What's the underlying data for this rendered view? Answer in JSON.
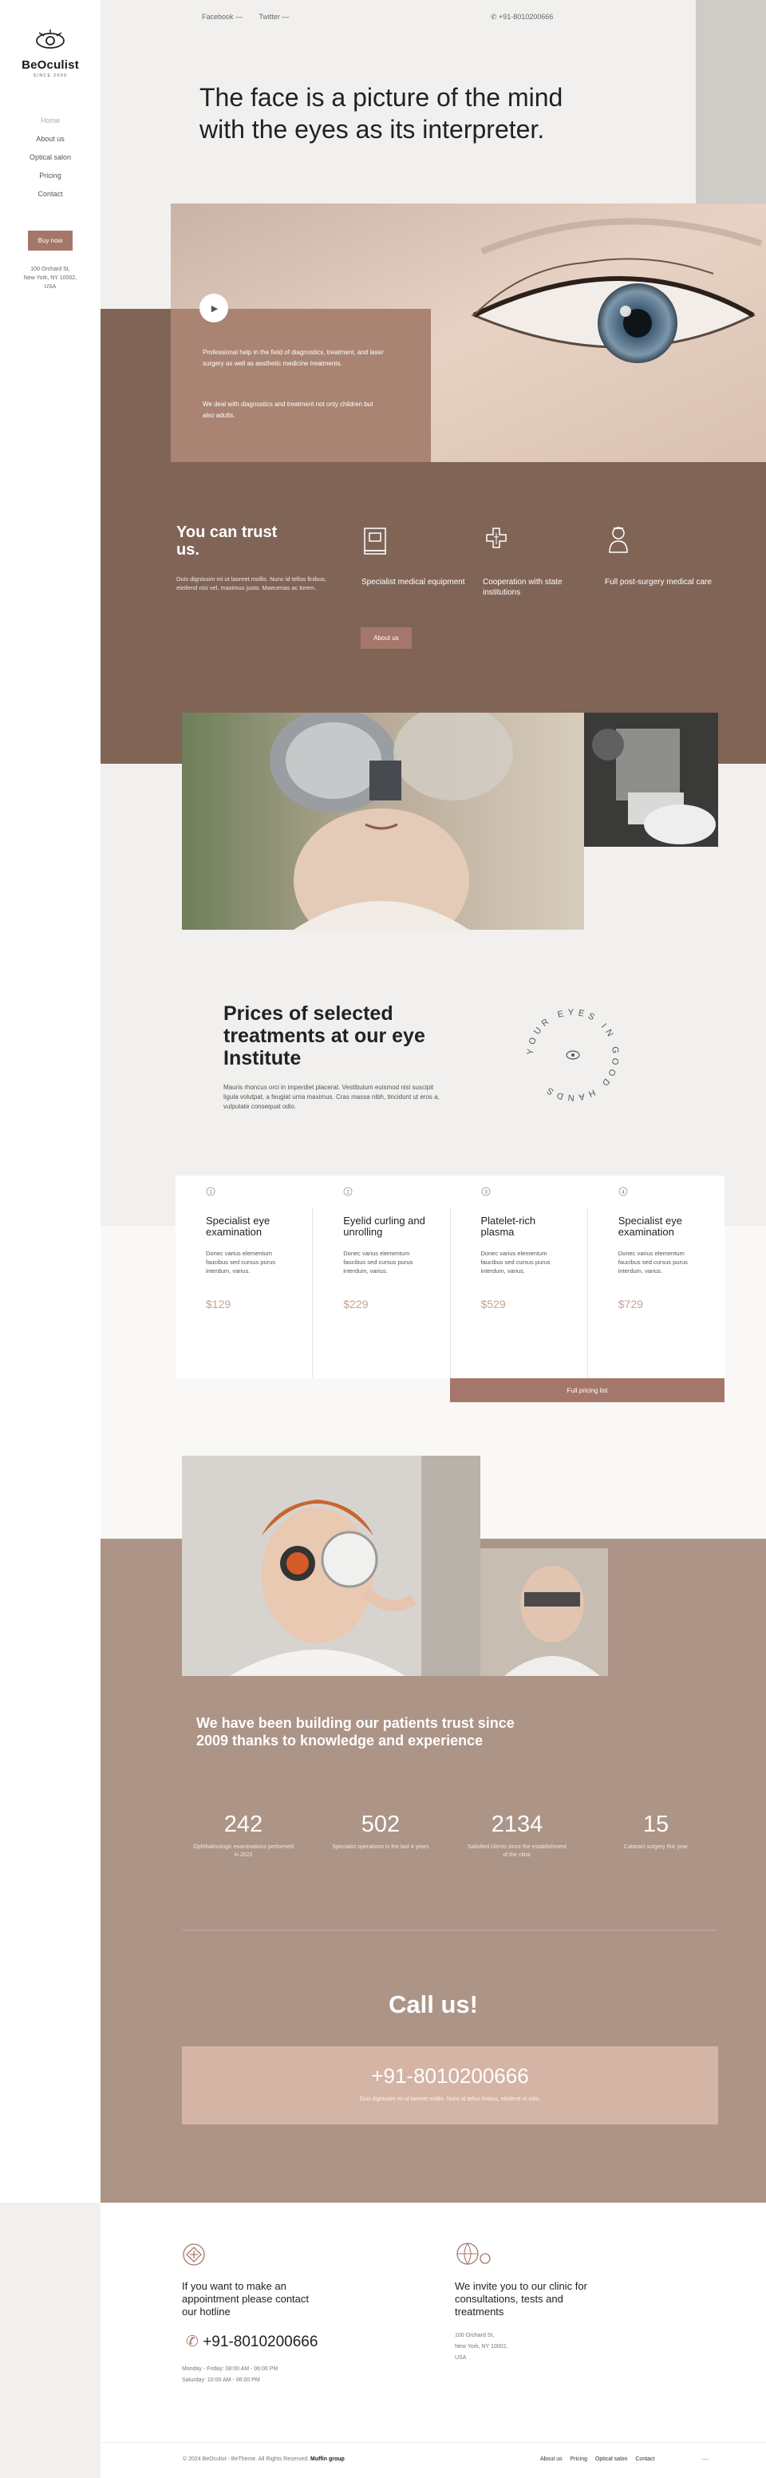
{
  "brand": {
    "name": "BeOculist",
    "tagline": "SINCE 2009"
  },
  "nav": {
    "items": [
      "Home",
      "About us",
      "Optical salon",
      "Pricing",
      "Contact"
    ],
    "active": "Home"
  },
  "sidebar": {
    "buy_label": "Buy now",
    "address": [
      "100 Orchard St,",
      "New York, NY 10002,",
      "USA"
    ]
  },
  "topbar": {
    "facebook": "Facebook —",
    "twitter": "Twitter —",
    "phone": "+91-8010200666"
  },
  "hero": {
    "title": "The face is a picture of the mind with the eyes as its interpreter.",
    "text1": "Professional help in the field of diagnostics, treatment, and laser surgery as well as aesthetic medicine treatments.",
    "text2": "We deal with diagnostics and treatment not only children but also adults."
  },
  "trust": {
    "title": "You can trust us.",
    "desc": "Duis dignissim mi ut laoreet mollis. Nunc id tellus finibus, eleifend nisi vel, maximus justo. Maecenas ac lorem.",
    "features": [
      {
        "icon": "equipment-icon",
        "label": "Specialist medical equipment"
      },
      {
        "icon": "cooperation-icon",
        "label": "Cooperation with state institutions"
      },
      {
        "icon": "doctor-icon",
        "label": "Full post-surgery medical care"
      }
    ],
    "about_label": "About us"
  },
  "prices": {
    "title": "Prices of selected treatments at our eye Institute",
    "desc": "Mauris rhoncus orci in imperdiet placerat. Vestibulum euismod nisl suscipit ligula volutpat, a feugiat urna maximus. Cras massa nibh, tincidunt ut eros a, vulputate consequat odio.",
    "stamp_text": "YOUR EYES IN GOOD HANDS",
    "cards": [
      {
        "num": "1",
        "title": "Specialist eye examination",
        "desc": "Donec varius elementum faucibus sed cursus purus interdum, varius.",
        "price": "$129"
      },
      {
        "num": "2",
        "title": "Eyelid curling and unrolling",
        "desc": "Donec varius elementum faucibus sed cursus purus interdum, varius.",
        "price": "$229"
      },
      {
        "num": "3",
        "title": "Platelet-rich plasma",
        "desc": "Donec varius elementum faucibus sed cursus purus interdum, varius.",
        "price": "$529"
      },
      {
        "num": "4",
        "title": "Specialist eye examination",
        "desc": "Donec varius elementum faucibus sed cursus purus interdum, varius.",
        "price": "$729"
      }
    ],
    "full_pricing_label": "Full pricing list"
  },
  "stats": {
    "title": "We have been building our patients trust since 2009 thanks to knowledge and experience",
    "items": [
      {
        "num": "242",
        "label": "Ophthalmologic examinations performed in 2022"
      },
      {
        "num": "502",
        "label": "Specialist operations in the last 4 years"
      },
      {
        "num": "2134",
        "label": "Satisfied clients since the establishment of the clinic"
      },
      {
        "num": "15",
        "label": "Cataract surgery this year"
      }
    ]
  },
  "call": {
    "title": "Call us!",
    "phone": "+91-8010200666",
    "desc": "Duis dignissim mi ut laoreet mollis. Nunc id tellus finibus, eleifend ut odio."
  },
  "footer": {
    "hotline_text": "If you want to make an appointment please contact our hotline",
    "phone": "+91-8010200666",
    "hours1": "Monday - Friday: 08:00 AM - 06:00 PM",
    "hours2": "Saturday: 10:00 AM - 06:00 PM",
    "invite_text": "We invite you to our clinic for consultations, tests and treatments",
    "address": [
      "100 Orchard St,",
      "New York, NY 10002,",
      "USA"
    ],
    "copyright": "© 2024 BeOculist - BeTheme. All Rights Reserved.",
    "copyright_brand": "Muffin group",
    "links": [
      "About us",
      "Pricing",
      "Optical salon",
      "Contact"
    ],
    "scroll_top": "—"
  },
  "colors": {
    "brown": "#806557",
    "accent": "#a5776a",
    "taupe": "#ac9487",
    "blush": "#d4b4a5"
  }
}
